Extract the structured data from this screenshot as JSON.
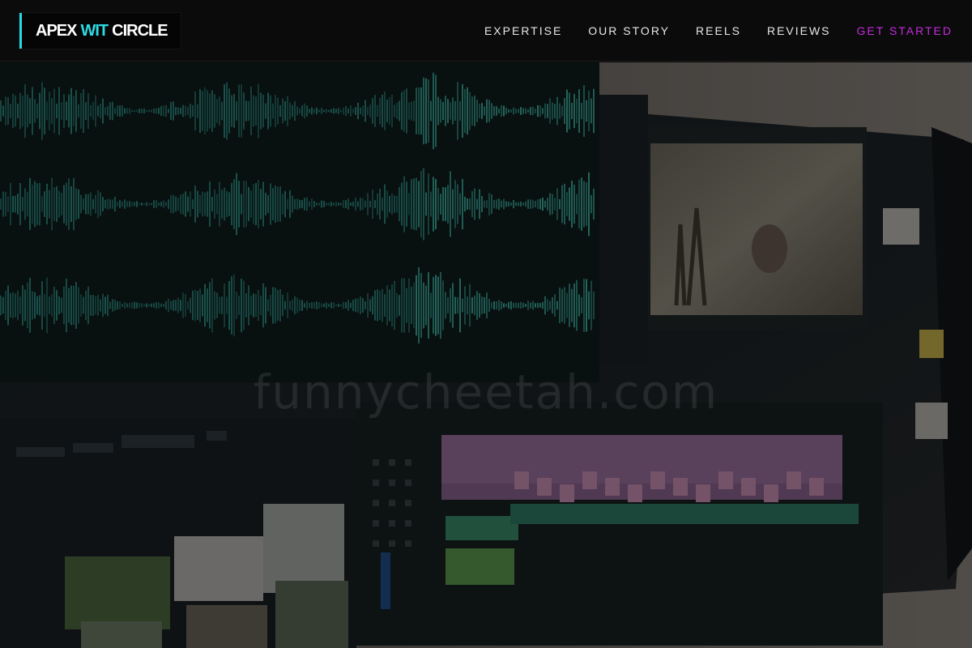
{
  "brand": {
    "part1": "APEX",
    "part2": "WIT",
    "part3": "CIRCLE",
    "accent_color": "#2fd9e4"
  },
  "nav": {
    "items": [
      {
        "label": "EXPERTISE"
      },
      {
        "label": "OUR STORY"
      },
      {
        "label": "REELS"
      },
      {
        "label": "REVIEWS"
      }
    ],
    "cta": {
      "label": "GET STARTED",
      "color": "#c42bdc"
    }
  },
  "hero": {
    "watermark": "funnycheetah.com"
  }
}
